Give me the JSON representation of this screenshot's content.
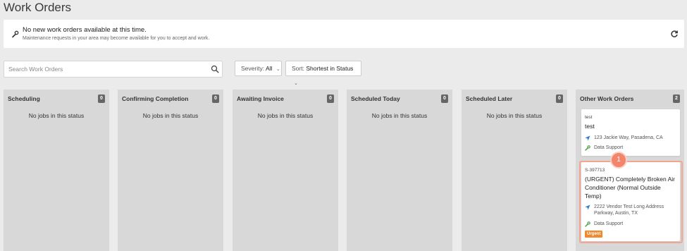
{
  "page": {
    "title": "Work Orders"
  },
  "banner": {
    "title": "No new work orders available at this time.",
    "subtitle": "Maintenance requests in your area may become available for you to accept and work.",
    "left_icon": "wrench-icon",
    "refresh_icon": "refresh-icon"
  },
  "search": {
    "placeholder": "Search Work Orders",
    "value": "",
    "icon": "search-icon"
  },
  "filters": {
    "severity_label": "Severity:",
    "severity_value": "All",
    "sort_label": "Sort:",
    "sort_value": "Shortest in Status"
  },
  "columns": [
    {
      "title": "Scheduling",
      "count": "0",
      "empty": "No jobs in this status"
    },
    {
      "title": "Confirming Completion",
      "count": "0",
      "empty": "No jobs in this status"
    },
    {
      "title": "Awaiting Invoice",
      "count": "0",
      "empty": "No jobs in this status"
    },
    {
      "title": "Scheduled Today",
      "count": "0",
      "empty": "No jobs in this status"
    },
    {
      "title": "Scheduled Later",
      "count": "0",
      "empty": "No jobs in this status"
    },
    {
      "title": "Other Work Orders",
      "count": "2",
      "empty": ""
    }
  ],
  "cards": [
    {
      "id": "test",
      "title": "test",
      "address": "123 Jackie Way, Pasadena, CA",
      "vendor": "Data Support"
    },
    {
      "id": "S-397713",
      "title_line1": "(URGENT) Completely Broken Air",
      "title_line2": "Conditioner (Normal Outside",
      "title_line3": "Temp)",
      "address_line1": "2222 Vendor Test Long Address",
      "address_line2": "Parkway, Austin, TX",
      "vendor": "Data Support",
      "badge": "Urgent"
    }
  ],
  "annotation": {
    "step": "1"
  },
  "colors": {
    "urgent": "#f08a2c",
    "badge": "#666666",
    "highlight": "#f3a58f",
    "step": "#f2856b",
    "icon_blue": "#2a7fd4",
    "icon_green": "#3a9a3a"
  }
}
